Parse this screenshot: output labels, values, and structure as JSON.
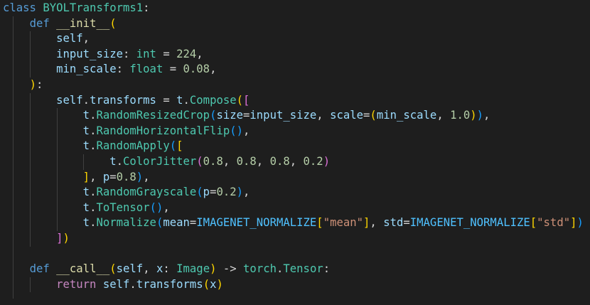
{
  "editor": {
    "language": "python",
    "theme_colors": {
      "background": "#1e1e1e",
      "keyword": "#569cd6",
      "control": "#c586c0",
      "class": "#4ec9b0",
      "function": "#dcdcaa",
      "parameter": "#9cdcfe",
      "number": "#b5cea8",
      "string": "#ce9178",
      "constant": "#4fc1ff",
      "bracket1": "#ffd700",
      "bracket2": "#da70d6",
      "bracket3": "#179fff"
    },
    "lines": [
      [
        [
          "kw",
          "class"
        ],
        [
          "plain",
          " "
        ],
        [
          "cls",
          "BYOLTransforms1"
        ],
        [
          "plain",
          ":"
        ]
      ],
      [
        [
          "plain",
          "    "
        ],
        [
          "kw",
          "def"
        ],
        [
          "plain",
          " "
        ],
        [
          "fn",
          "__init__"
        ],
        [
          "b1",
          "("
        ]
      ],
      [
        [
          "plain",
          "        "
        ],
        [
          "param",
          "self"
        ],
        [
          "plain",
          ","
        ]
      ],
      [
        [
          "plain",
          "        "
        ],
        [
          "param",
          "input_size"
        ],
        [
          "plain",
          ": "
        ],
        [
          "cls",
          "int"
        ],
        [
          "plain",
          " = "
        ],
        [
          "num",
          "224"
        ],
        [
          "plain",
          ","
        ]
      ],
      [
        [
          "plain",
          "        "
        ],
        [
          "param",
          "min_scale"
        ],
        [
          "plain",
          ": "
        ],
        [
          "cls",
          "float"
        ],
        [
          "plain",
          " = "
        ],
        [
          "num",
          "0.08"
        ],
        [
          "plain",
          ","
        ]
      ],
      [
        [
          "plain",
          "    "
        ],
        [
          "b1",
          ")"
        ],
        [
          "plain",
          ":"
        ]
      ],
      [
        [
          "plain",
          "        "
        ],
        [
          "param",
          "self"
        ],
        [
          "plain",
          "."
        ],
        [
          "param",
          "transforms"
        ],
        [
          "plain",
          " = "
        ],
        [
          "param",
          "t"
        ],
        [
          "plain",
          "."
        ],
        [
          "cls",
          "Compose"
        ],
        [
          "b1",
          "("
        ],
        [
          "b2",
          "["
        ]
      ],
      [
        [
          "plain",
          "            "
        ],
        [
          "param",
          "t"
        ],
        [
          "plain",
          "."
        ],
        [
          "cls",
          "RandomResizedCrop"
        ],
        [
          "b3",
          "("
        ],
        [
          "param",
          "size"
        ],
        [
          "plain",
          "="
        ],
        [
          "param",
          "input_size"
        ],
        [
          "plain",
          ", "
        ],
        [
          "param",
          "scale"
        ],
        [
          "plain",
          "="
        ],
        [
          "b1",
          "("
        ],
        [
          "param",
          "min_scale"
        ],
        [
          "plain",
          ", "
        ],
        [
          "num",
          "1.0"
        ],
        [
          "b1",
          ")"
        ],
        [
          "b3",
          ")"
        ],
        [
          "plain",
          ","
        ]
      ],
      [
        [
          "plain",
          "            "
        ],
        [
          "param",
          "t"
        ],
        [
          "plain",
          "."
        ],
        [
          "cls",
          "RandomHorizontalFlip"
        ],
        [
          "b3",
          "()"
        ],
        [
          "plain",
          ","
        ]
      ],
      [
        [
          "plain",
          "            "
        ],
        [
          "param",
          "t"
        ],
        [
          "plain",
          "."
        ],
        [
          "cls",
          "RandomApply"
        ],
        [
          "b3",
          "("
        ],
        [
          "b1",
          "["
        ]
      ],
      [
        [
          "plain",
          "                "
        ],
        [
          "param",
          "t"
        ],
        [
          "plain",
          "."
        ],
        [
          "cls",
          "ColorJitter"
        ],
        [
          "b2",
          "("
        ],
        [
          "num",
          "0.8"
        ],
        [
          "plain",
          ", "
        ],
        [
          "num",
          "0.8"
        ],
        [
          "plain",
          ", "
        ],
        [
          "num",
          "0.8"
        ],
        [
          "plain",
          ", "
        ],
        [
          "num",
          "0.2"
        ],
        [
          "b2",
          ")"
        ]
      ],
      [
        [
          "plain",
          "            "
        ],
        [
          "b1",
          "]"
        ],
        [
          "plain",
          ", "
        ],
        [
          "param",
          "p"
        ],
        [
          "plain",
          "="
        ],
        [
          "num",
          "0.8"
        ],
        [
          "b3",
          ")"
        ],
        [
          "plain",
          ","
        ]
      ],
      [
        [
          "plain",
          "            "
        ],
        [
          "param",
          "t"
        ],
        [
          "plain",
          "."
        ],
        [
          "cls",
          "RandomGrayscale"
        ],
        [
          "b3",
          "("
        ],
        [
          "param",
          "p"
        ],
        [
          "plain",
          "="
        ],
        [
          "num",
          "0.2"
        ],
        [
          "b3",
          ")"
        ],
        [
          "plain",
          ","
        ]
      ],
      [
        [
          "plain",
          "            "
        ],
        [
          "param",
          "t"
        ],
        [
          "plain",
          "."
        ],
        [
          "cls",
          "ToTensor"
        ],
        [
          "b3",
          "()"
        ],
        [
          "plain",
          ","
        ]
      ],
      [
        [
          "plain",
          "            "
        ],
        [
          "param",
          "t"
        ],
        [
          "plain",
          "."
        ],
        [
          "cls",
          "Normalize"
        ],
        [
          "b3",
          "("
        ],
        [
          "param",
          "mean"
        ],
        [
          "plain",
          "="
        ],
        [
          "const",
          "IMAGENET_NORMALIZE"
        ],
        [
          "b1",
          "["
        ],
        [
          "str",
          "\"mean\""
        ],
        [
          "b1",
          "]"
        ],
        [
          "plain",
          ", "
        ],
        [
          "param",
          "std"
        ],
        [
          "plain",
          "="
        ],
        [
          "const",
          "IMAGENET_NORMALIZE"
        ],
        [
          "b1",
          "["
        ],
        [
          "str",
          "\"std\""
        ],
        [
          "b1",
          "]"
        ],
        [
          "b3",
          ")"
        ]
      ],
      [
        [
          "plain",
          "        "
        ],
        [
          "b2",
          "]"
        ],
        [
          "b1",
          ")"
        ]
      ],
      [
        [
          "plain",
          ""
        ]
      ],
      [
        [
          "plain",
          "    "
        ],
        [
          "kw",
          "def"
        ],
        [
          "plain",
          " "
        ],
        [
          "fn",
          "__call__"
        ],
        [
          "b1",
          "("
        ],
        [
          "param",
          "self"
        ],
        [
          "plain",
          ", "
        ],
        [
          "param",
          "x"
        ],
        [
          "plain",
          ": "
        ],
        [
          "cls",
          "Image"
        ],
        [
          "b1",
          ")"
        ],
        [
          "plain",
          " -> "
        ],
        [
          "cls",
          "torch"
        ],
        [
          "plain",
          "."
        ],
        [
          "cls",
          "Tensor"
        ],
        [
          "plain",
          ":"
        ]
      ],
      [
        [
          "plain",
          "        "
        ],
        [
          "ctrl",
          "return"
        ],
        [
          "plain",
          " "
        ],
        [
          "param",
          "self"
        ],
        [
          "plain",
          "."
        ],
        [
          "param",
          "transforms"
        ],
        [
          "b1",
          "("
        ],
        [
          "param",
          "x"
        ],
        [
          "b1",
          ")"
        ]
      ]
    ]
  }
}
